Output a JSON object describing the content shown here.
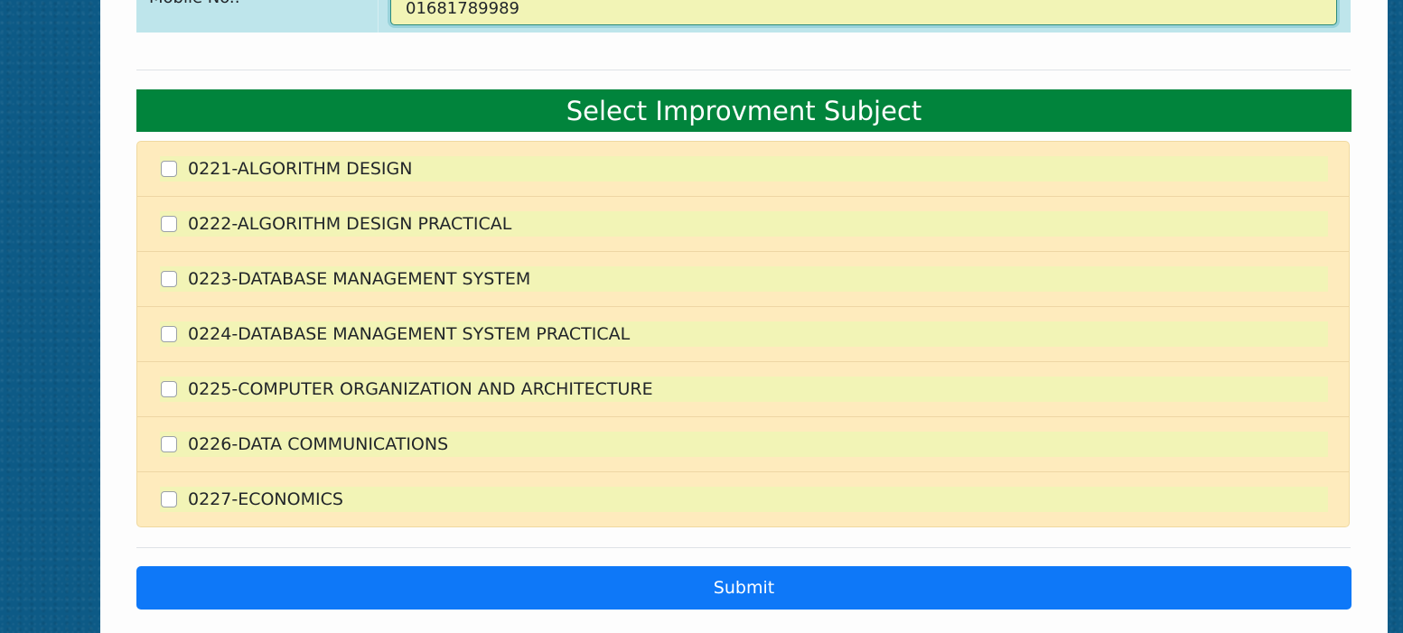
{
  "form": {
    "mobile": {
      "label": "Mobile No.:",
      "value": "01681789989"
    },
    "section_title": "Select Improvment Subject",
    "subjects": [
      {
        "label": "0221-ALGORITHM DESIGN",
        "checked": false
      },
      {
        "label": "0222-ALGORITHM DESIGN PRACTICAL",
        "checked": false
      },
      {
        "label": "0223-DATABASE MANAGEMENT SYSTEM",
        "checked": false
      },
      {
        "label": "0224-DATABASE MANAGEMENT SYSTEM PRACTICAL",
        "checked": false
      },
      {
        "label": "0225-COMPUTER ORGANIZATION AND ARCHITECTURE",
        "checked": false
      },
      {
        "label": "0226-DATA COMMUNICATIONS",
        "checked": false
      },
      {
        "label": "0227-ECONOMICS",
        "checked": false
      }
    ],
    "submit_label": "Submit"
  },
  "colors": {
    "page_background": "#0d5a86",
    "section_header": "#01843c",
    "subject_panel": "#feebbd",
    "subject_highlight": "#f2f4b6",
    "submit_button": "#0e78f8",
    "label_cell": "#bee5eb"
  }
}
